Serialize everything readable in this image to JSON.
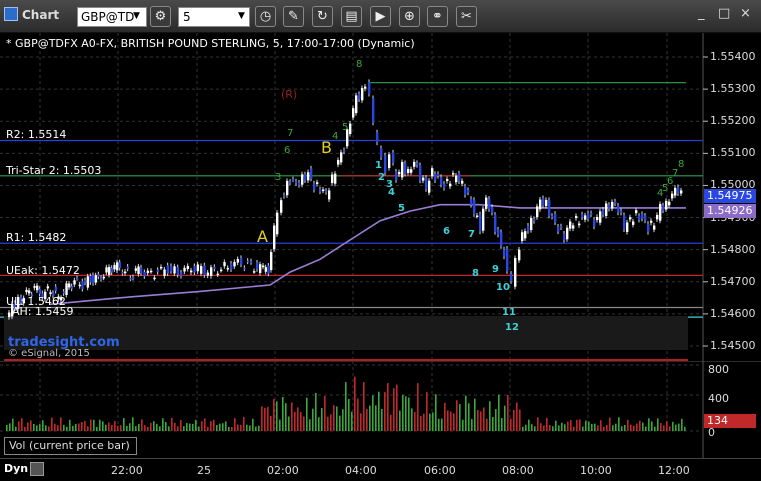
{
  "toolbar": {
    "title": "Chart",
    "symbol": "GBP@TD",
    "interval": "5",
    "window_controls": [
      "_",
      "□",
      "×"
    ]
  },
  "header": {
    "description": "* GBP@TDFX A0-FX, BRITISH POUND STERLING, 5, 17:00-17:00 (Dynamic)"
  },
  "levels": {
    "r2": "R2: 1.5514",
    "tristar": "Tri-Star 2: 1.5503",
    "r1": "R1: 1.5482",
    "ue": "UE",
    "ue_rest": "ak: 1.5472",
    "ul": "U",
    "ul_rest": "L: 1.5462",
    "ah": "AH: 1.5459"
  },
  "annotations": {
    "r_marker": "(R)",
    "a": "A",
    "b": "B",
    "watermark": "tradesight.com",
    "copyright": "© eSignal, 2015"
  },
  "price_scale": {
    "ticks": [
      "1.55400",
      "1.55300",
      "1.55200",
      "1.55100",
      "1.55000",
      "1.54900",
      "1.54800",
      "1.54700",
      "1.54600",
      "1.54500"
    ],
    "last_price": "1.54975",
    "vwap_price": "1.54926"
  },
  "volume": {
    "label": "Vol (current price bar)",
    "ticks": [
      "800",
      "400",
      "0"
    ],
    "current": "134"
  },
  "time_axis": {
    "mode": "Dyn",
    "labels": [
      "22:00",
      "25",
      "02:00",
      "04:00",
      "06:00",
      "08:00",
      "10:00",
      "12:00"
    ]
  },
  "colors": {
    "bull": "#ffffff",
    "bear": "#2a48e0",
    "vwap": "#9a7ed6",
    "r_levels": "#2a3ddf",
    "tristar": "#2fa34a",
    "red_level": "#c0282a",
    "td_cyan": "#3fd1d8",
    "td_green": "#3aa83a"
  },
  "td_counts": {
    "green_top": [
      "8",
      "7",
      "6",
      "5",
      "4",
      "3"
    ],
    "cyan": [
      "1",
      "2",
      "3",
      "4",
      "5",
      "6",
      "7",
      "8",
      "9",
      "10",
      "11",
      "12"
    ],
    "green_right": [
      "8",
      "7",
      "6",
      "5",
      "4"
    ]
  }
}
